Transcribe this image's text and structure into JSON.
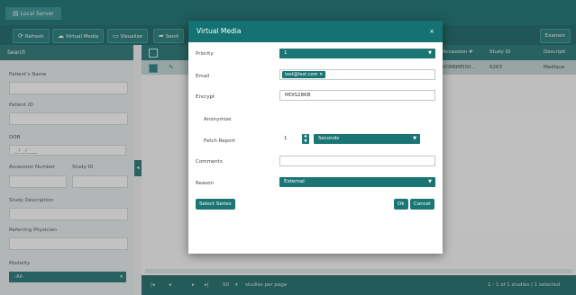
{
  "app": {
    "tab": "Local Server"
  },
  "toolbar": {
    "refresh": "Refresh",
    "virtual_media": "Virtual Media",
    "visualize": "Visualize",
    "send": "Send",
    "examine": "Examen"
  },
  "search": {
    "header": "Search",
    "patients_name": "Patient's Name",
    "patient_id": "Patient ID",
    "dob": "DOB",
    "dob_placeholder": "__/__/____",
    "accession_number": "Accession Number",
    "study_id": "Study ID",
    "study_description": "Study Description",
    "referring_physician": "Referring Physician",
    "modality": "Modality",
    "modality_value": "-All-"
  },
  "grid": {
    "headers": {
      "accession": "Accession #",
      "study_id": "Study ID",
      "description": "Descripti"
    },
    "row": {
      "accession": "VONNM500...",
      "study_id": "6263",
      "description": "Medique"
    },
    "footer": {
      "page_size": "50",
      "per_page": "studies per page",
      "status": "1 - 1 of 1 studies | 1 selected"
    }
  },
  "modal": {
    "title": "Virtual Media",
    "close": "×",
    "priority_label": "Priority",
    "priority_value": "1",
    "email_label": "Email",
    "email_chip": "test@test.com",
    "encrypt_label": "Encrypt",
    "encrypt_value": "MDIS28KB",
    "anonymize_label": "Anonymize",
    "fetch_report_label": "Fetch Report",
    "fetch_value": "1",
    "fetch_unit": "Seconds",
    "comments_label": "Comments",
    "reason_label": "Reason",
    "reason_value": "External",
    "select_series": "Select Series",
    "ok": "Ok",
    "cancel": "Cancel"
  },
  "colors": {
    "primary": "#157272",
    "dark": "#0d6a6a",
    "row_selected": "#bfd4d4"
  }
}
